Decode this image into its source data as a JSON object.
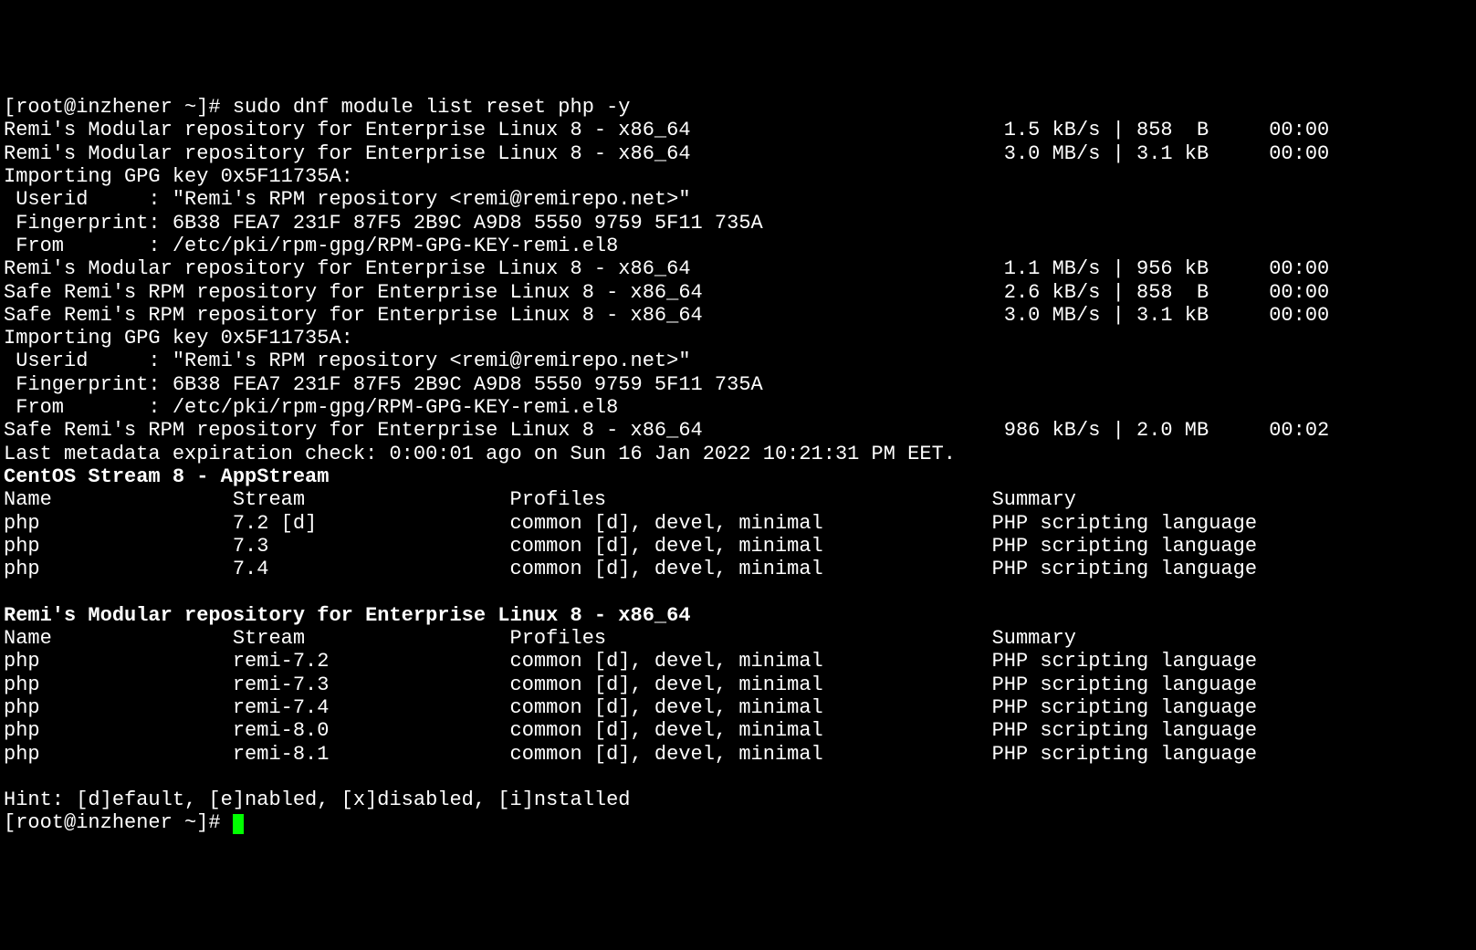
{
  "prompt1": "[root@inzhener ~]# ",
  "command": "sudo dnf module list reset php -y",
  "repos": [
    {
      "name": "Remi's Modular repository for Enterprise Linux 8 - x86_64",
      "speed": "1.5 kB/s",
      "size": "858  B",
      "time": "00:00"
    },
    {
      "name": "Remi's Modular repository for Enterprise Linux 8 - x86_64",
      "speed": "3.0 MB/s",
      "size": "3.1 kB",
      "time": "00:00"
    }
  ],
  "gpg1": {
    "header": "Importing GPG key 0x5F11735A:",
    "userid": " Userid     : \"Remi's RPM repository <remi@remirepo.net>\"",
    "fingerprint": " Fingerprint: 6B38 FEA7 231F 87F5 2B9C A9D8 5550 9759 5F11 735A",
    "from": " From       : /etc/pki/rpm-gpg/RPM-GPG-KEY-remi.el8"
  },
  "repos2": [
    {
      "name": "Remi's Modular repository for Enterprise Linux 8 - x86_64",
      "speed": "1.1 MB/s",
      "size": "956 kB",
      "time": "00:00"
    },
    {
      "name": "Safe Remi's RPM repository for Enterprise Linux 8 - x86_64",
      "speed": "2.6 kB/s",
      "size": "858  B",
      "time": "00:00"
    },
    {
      "name": "Safe Remi's RPM repository for Enterprise Linux 8 - x86_64",
      "speed": "3.0 MB/s",
      "size": "3.1 kB",
      "time": "00:00"
    }
  ],
  "gpg2": {
    "header": "Importing GPG key 0x5F11735A:",
    "userid": " Userid     : \"Remi's RPM repository <remi@remirepo.net>\"",
    "fingerprint": " Fingerprint: 6B38 FEA7 231F 87F5 2B9C A9D8 5550 9759 5F11 735A",
    "from": " From       : /etc/pki/rpm-gpg/RPM-GPG-KEY-remi.el8"
  },
  "repos3": [
    {
      "name": "Safe Remi's RPM repository for Enterprise Linux 8 - x86_64",
      "speed": "986 kB/s",
      "size": "2.0 MB",
      "time": "00:02"
    }
  ],
  "metadata": "Last metadata expiration check: 0:00:01 ago on Sun 16 Jan 2022 10:21:31 PM EET.",
  "section1": {
    "title": "CentOS Stream 8 - AppStream",
    "header": {
      "name": "Name",
      "stream": "Stream",
      "profiles": "Profiles",
      "summary": "Summary"
    },
    "rows": [
      {
        "name": "php",
        "stream": "7.2 [d]",
        "profiles": "common [d], devel, minimal",
        "summary": "PHP scripting language"
      },
      {
        "name": "php",
        "stream": "7.3",
        "profiles": "common [d], devel, minimal",
        "summary": "PHP scripting language"
      },
      {
        "name": "php",
        "stream": "7.4",
        "profiles": "common [d], devel, minimal",
        "summary": "PHP scripting language"
      }
    ]
  },
  "section2": {
    "title": "Remi's Modular repository for Enterprise Linux 8 - x86_64",
    "header": {
      "name": "Name",
      "stream": "Stream",
      "profiles": "Profiles",
      "summary": "Summary"
    },
    "rows": [
      {
        "name": "php",
        "stream": "remi-7.2",
        "profiles": "common [d], devel, minimal",
        "summary": "PHP scripting language"
      },
      {
        "name": "php",
        "stream": "remi-7.3",
        "profiles": "common [d], devel, minimal",
        "summary": "PHP scripting language"
      },
      {
        "name": "php",
        "stream": "remi-7.4",
        "profiles": "common [d], devel, minimal",
        "summary": "PHP scripting language"
      },
      {
        "name": "php",
        "stream": "remi-8.0",
        "profiles": "common [d], devel, minimal",
        "summary": "PHP scripting language"
      },
      {
        "name": "php",
        "stream": "remi-8.1",
        "profiles": "common [d], devel, minimal",
        "summary": "PHP scripting language"
      }
    ]
  },
  "hint": "Hint: [d]efault, [e]nabled, [x]disabled, [i]nstalled",
  "prompt2": "[root@inzhener ~]# "
}
